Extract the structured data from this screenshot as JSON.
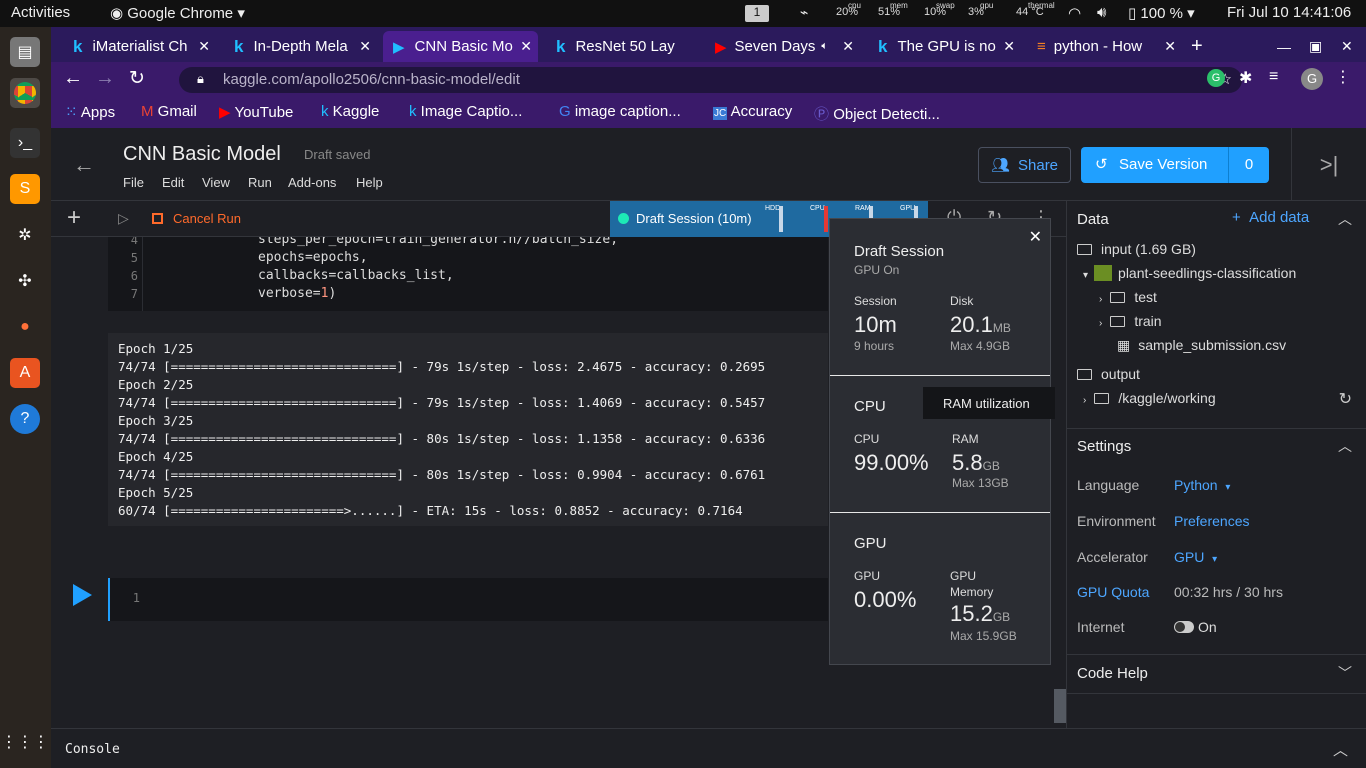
{
  "os": {
    "activities": "Activities",
    "app": "Google Chrome",
    "workspace": "1",
    "stats": [
      {
        "label": "cpu",
        "value": "20%"
      },
      {
        "label": "mem",
        "value": "51%"
      },
      {
        "label": "swap",
        "value": "10%"
      },
      {
        "label": "gpu",
        "value": "3%"
      },
      {
        "label": "thermal",
        "value": "44 °C"
      }
    ],
    "battery": "100 %",
    "clock": "Fri Jul 10  14:41:06"
  },
  "browser": {
    "tabs": [
      {
        "title": "iMaterialist Ch",
        "icon": "k"
      },
      {
        "title": "In-Depth Mela",
        "icon": "k"
      },
      {
        "title": "CNN Basic Mo",
        "icon": "kaggle-play"
      },
      {
        "title": "ResNet 50 Lay",
        "icon": "k"
      },
      {
        "title": "Seven Days",
        "icon": "youtube"
      },
      {
        "title": "The GPU is no",
        "icon": "k"
      },
      {
        "title": "python - How",
        "icon": "stackoverflow"
      }
    ],
    "url_domain": "kaggle.com",
    "url_path": "/apollo2506/cnn-basic-model/edit",
    "profile": "G",
    "bookmarks": [
      {
        "label": "Apps",
        "icon": "apps-grid"
      },
      {
        "label": "Gmail",
        "icon": "gmail"
      },
      {
        "label": "YouTube",
        "icon": "youtube"
      },
      {
        "label": "Kaggle",
        "icon": "k"
      },
      {
        "label": "Image Captio...",
        "icon": "k"
      },
      {
        "label": "image caption...",
        "icon": "google"
      },
      {
        "label": "Accuracy",
        "icon": "jc"
      },
      {
        "label": "Object Detecti...",
        "icon": "p"
      }
    ]
  },
  "kernel": {
    "title": "CNN Basic Model",
    "status": "Draft saved",
    "menu": [
      "File",
      "Edit",
      "View",
      "Run",
      "Add-ons",
      "Help"
    ],
    "share": "Share",
    "save_version": "Save Version",
    "version_count": "0",
    "cancel_run": "Cancel Run",
    "session_label": "Draft Session (10m)",
    "meters": [
      "HDD",
      "CPU",
      "RAM",
      "GPU"
    ]
  },
  "code_cell": {
    "lines": [
      {
        "num": "4",
        "text": "steps_per_epoch=train_generator.n//batch_size,"
      },
      {
        "num": "5",
        "text": "epochs=epochs,"
      },
      {
        "num": "6",
        "text": "callbacks=callbacks_list,"
      },
      {
        "num": "7",
        "pre": "verbose=",
        "n": "1",
        "post": ")"
      }
    ]
  },
  "output": [
    "Epoch 1/25",
    "74/74 [==============================] - 79s 1s/step - loss: 2.4675 - accuracy: 0.2695",
    "Epoch 2/25",
    "74/74 [==============================] - 79s 1s/step - loss: 1.4069 - accuracy: 0.5457",
    "Epoch 3/25",
    "74/74 [==============================] - 80s 1s/step - loss: 1.1358 - accuracy: 0.6336",
    "Epoch 4/25",
    "74/74 [==============================] - 80s 1s/step - loss: 0.9904 - accuracy: 0.6761",
    "Epoch 5/25",
    "60/74 [=======================>......] - ETA: 15s - loss: 0.8852 - accuracy: 0.7164"
  ],
  "empty_cell_num": "1",
  "session_popup": {
    "title": "Draft Session",
    "subtitle": "GPU On",
    "session_label": "Session",
    "session_value": "10m",
    "session_limit": "9 hours",
    "disk_label": "Disk",
    "disk_value": "20.1",
    "disk_unit": "MB",
    "disk_max": "Max 4.9GB",
    "cpu_header": "CPU",
    "cpu_label": "CPU",
    "cpu_value": "99.00%",
    "ram_label": "RAM",
    "ram_value": "5.8",
    "ram_unit": "GB",
    "ram_max": "Max 13GB",
    "gpu_header": "GPU",
    "gpu_label": "GPU",
    "gpu_value": "0.00%",
    "gpu_mem_label1": "GPU",
    "gpu_mem_label2": "Memory",
    "gpu_mem_value": "15.2",
    "gpu_mem_unit": "GB",
    "gpu_mem_max": "Max 15.9GB",
    "tooltip": "RAM utilization"
  },
  "sidebar": {
    "data_title": "Data",
    "add_data": "Add data",
    "input": "input (1.69 GB)",
    "dataset": "plant-seedlings-classification",
    "folders": [
      "test",
      "train"
    ],
    "file": "sample_submission.csv",
    "output": "output",
    "working": "/kaggle/working",
    "settings_title": "Settings",
    "settings": {
      "language_label": "Language",
      "language_value": "Python",
      "environment_label": "Environment",
      "environment_value": "Preferences",
      "accelerator_label": "Accelerator",
      "accelerator_value": "GPU",
      "quota_label": "GPU Quota",
      "quota_value": "00:32 hrs / 30 hrs",
      "internet_label": "Internet",
      "internet_value": "On"
    },
    "code_help": "Code Help"
  },
  "console_label": "Console"
}
